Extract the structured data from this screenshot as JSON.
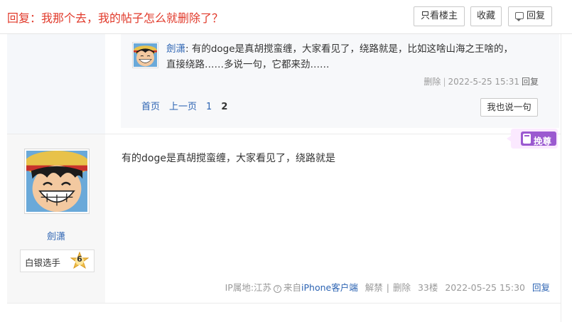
{
  "header": {
    "title": "回复：我那个去，我的帖子怎么就删除了？",
    "only_op_label": "只看楼主",
    "favorite_label": "收藏",
    "reply_label": "回复"
  },
  "sub_reply": {
    "username": "劍潇",
    "content_line1": "有的doge是真胡搅蛮缠，大家看见了，绕路就是，比如这啥山海之王啥的，",
    "content_line2": "直接绕路……多说一句，它都来劲……",
    "delete_label": "删除",
    "separator": "|",
    "timestamp": "2022-5-25 15:31",
    "reply_label": "回复"
  },
  "pager": {
    "first": "首页",
    "prev": "上一页",
    "pages": [
      "1",
      "2"
    ],
    "current": "2",
    "say_button": "我也说一句"
  },
  "post": {
    "author": "劍潇",
    "level_name": "白银选手",
    "level_num": "6",
    "content": "有的doge是真胡搅蛮缠，大家看见了，绕路就是",
    "tag": "挽尊",
    "ip_label": "IP属地:江苏",
    "source_prefix": "来自",
    "source_client": "iPhone客户端",
    "ban_label": "解禁",
    "sep": "|",
    "delete_label": "删除",
    "floor": "33楼",
    "timestamp": "2022-05-25 15:30",
    "reply_label": "回复"
  },
  "colors": {
    "title_red": "#e1392a",
    "link_blue": "#2d64b3",
    "tag_purple": "#9b59d0"
  }
}
